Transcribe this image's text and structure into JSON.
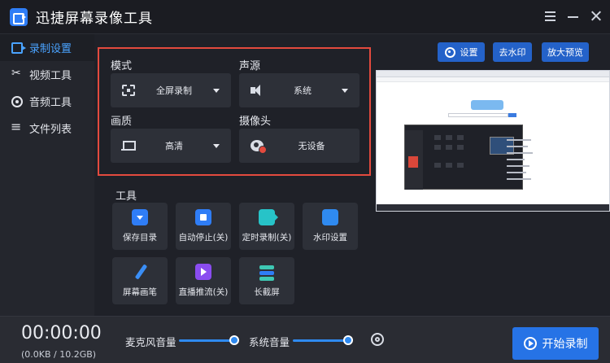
{
  "app": {
    "title": "迅捷屏幕录像工具"
  },
  "sidebar": {
    "items": [
      {
        "label": "录制设置",
        "icon": "record-icon",
        "active": true
      },
      {
        "label": "视频工具",
        "icon": "scissors-icon",
        "active": false
      },
      {
        "label": "音频工具",
        "icon": "audio-icon",
        "active": false
      },
      {
        "label": "文件列表",
        "icon": "list-icon",
        "active": false
      }
    ]
  },
  "settings": {
    "mode": {
      "label": "模式",
      "value": "全屏录制"
    },
    "audio": {
      "label": "声源",
      "value": "系统"
    },
    "quality": {
      "label": "画质",
      "value": "高清"
    },
    "camera": {
      "label": "摄像头",
      "value": "无设备"
    }
  },
  "tools": {
    "label": "工具",
    "items": [
      {
        "label": "保存目录",
        "icon": "folder-icon"
      },
      {
        "label": "自动停止(关)",
        "icon": "autostop-icon"
      },
      {
        "label": "定时录制(关)",
        "icon": "timer-icon"
      },
      {
        "label": "水印设置",
        "icon": "watermark-drop-icon"
      },
      {
        "label": "屏幕画笔",
        "icon": "pen-icon"
      },
      {
        "label": "直播推流(关)",
        "icon": "live-icon"
      },
      {
        "label": "长截屏",
        "icon": "long-screenshot-icon"
      }
    ]
  },
  "top_buttons": {
    "settings": "设置",
    "remove_watermark": "去水印",
    "zoom_preview": "放大预览"
  },
  "bottom": {
    "timer": "00:00:00",
    "size": "(0.0KB / 10.2GB)",
    "mic_label": "麦克风音量",
    "mic_level": 1.0,
    "system_label": "系统音量",
    "system_level": 1.0,
    "start_label": "开始录制"
  },
  "colors": {
    "accent": "#2f7df6",
    "highlight_border": "#e34a3e",
    "active_sidebar_text": "#4aa3ff"
  }
}
